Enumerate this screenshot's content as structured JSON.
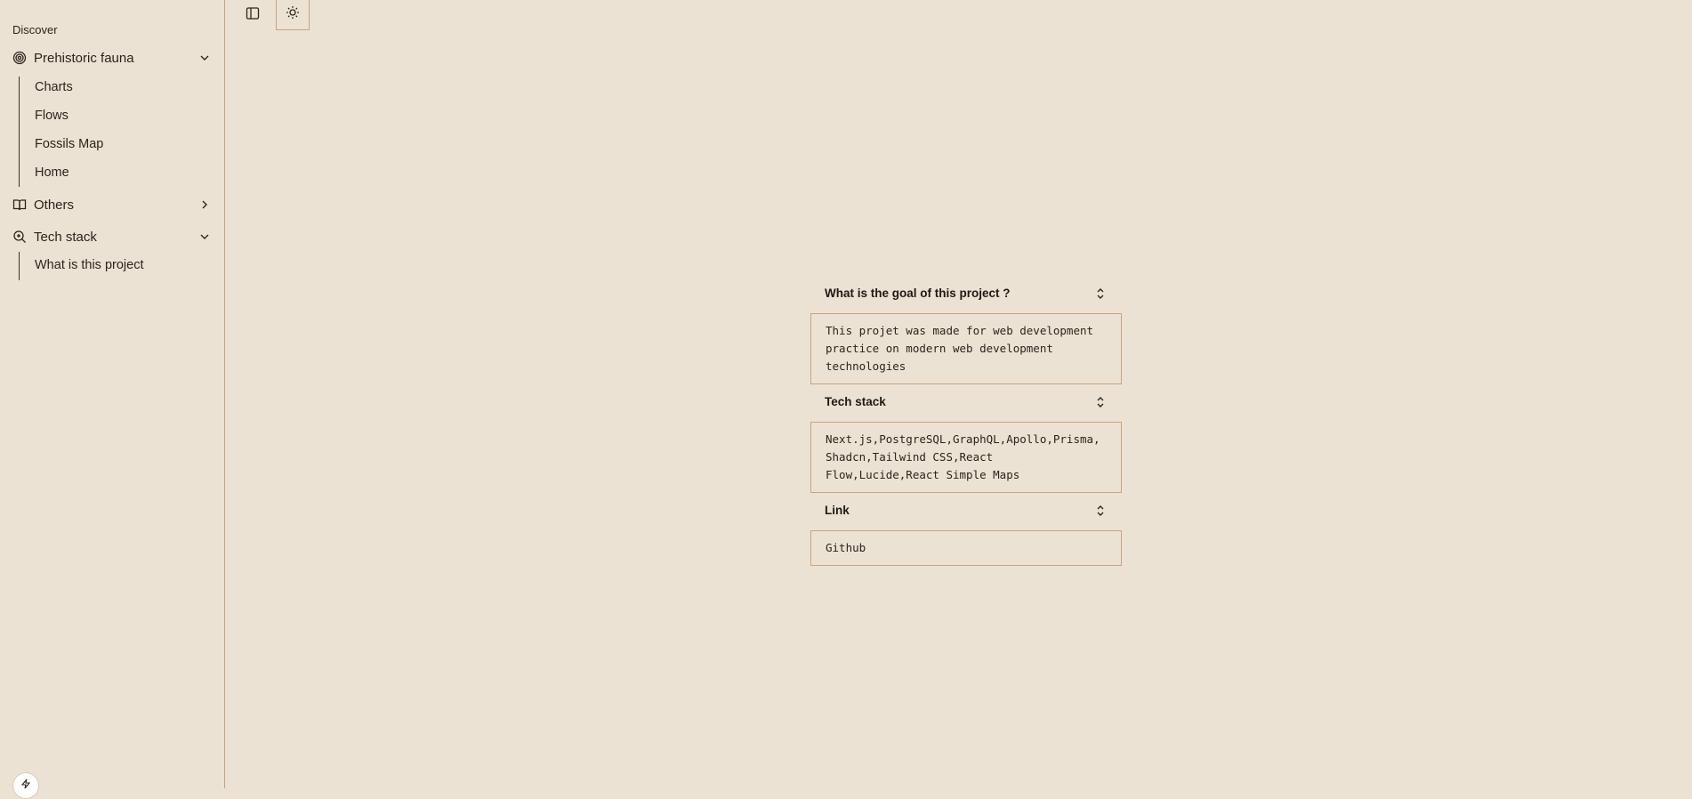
{
  "sidebar": {
    "group_label": "Discover",
    "sections": [
      {
        "label": "Prehistoric fauna",
        "icon": "spiral-icon",
        "expanded": true,
        "items": [
          "Charts",
          "Flows",
          "Fossils Map",
          "Home"
        ]
      },
      {
        "label": "Others",
        "icon": "book-icon",
        "expanded": false,
        "items": []
      },
      {
        "label": "Tech stack",
        "icon": "search-zoom-icon",
        "expanded": true,
        "items": [
          "What is this project"
        ]
      }
    ]
  },
  "toolbar": {
    "sidebar_toggle_icon": "panel-left-icon",
    "theme_toggle_icon": "sun-icon"
  },
  "accordion": [
    {
      "title": "What is the goal of this project ?",
      "content": "This projet was made for web development practice on modern web development technologies"
    },
    {
      "title": "Tech stack",
      "content": "Next.js,PostgreSQL,GraphQL,Apollo,Prisma,Shadcn,Tailwind CSS,React Flow,Lucide,React Simple Maps"
    },
    {
      "title": "Link",
      "content": "Github"
    }
  ],
  "colors": {
    "background": "#ece2d4",
    "border": "#c9a37c",
    "text": "#1f1a14"
  }
}
